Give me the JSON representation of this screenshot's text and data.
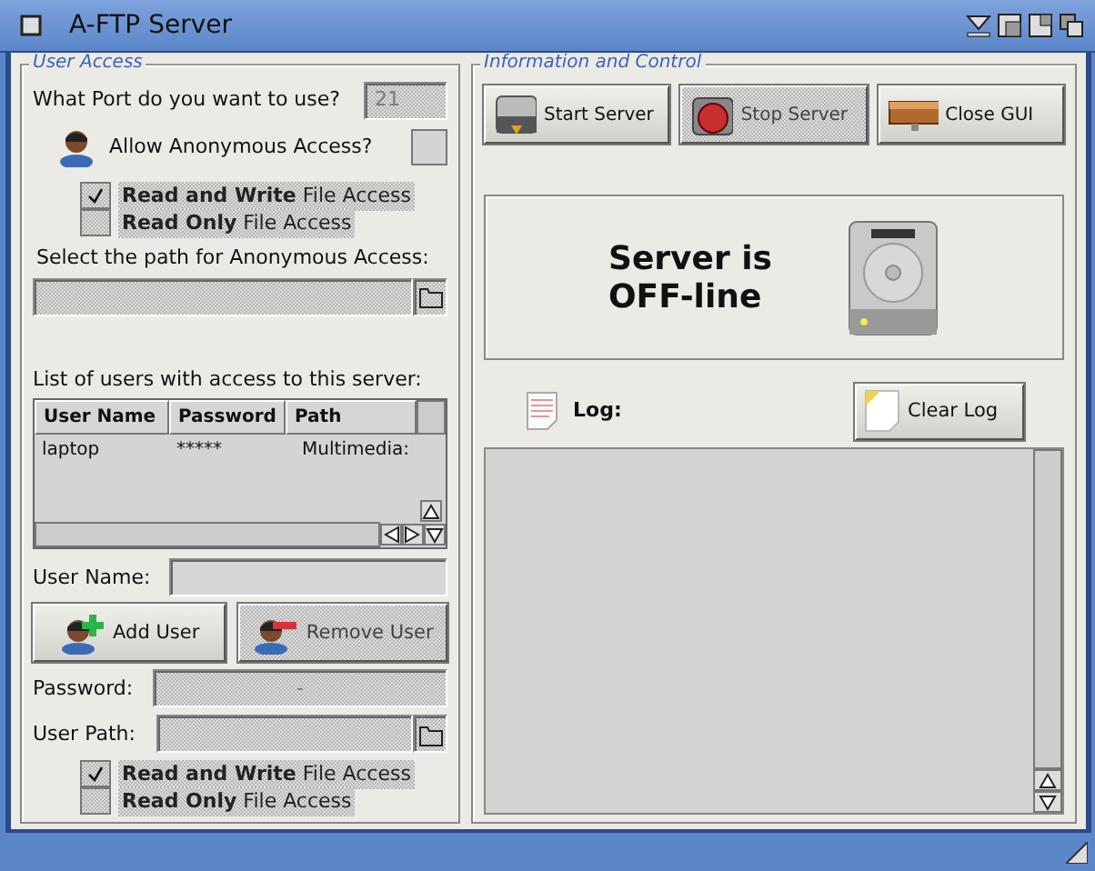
{
  "window": {
    "title": "A-FTP Server"
  },
  "user_access": {
    "title": "User Access",
    "port": {
      "label": "What Port do you want to use?",
      "value": "21",
      "disabled": true
    },
    "anonymous": {
      "label": "Allow Anonymous Access?",
      "checked": false
    },
    "anon_permissions": [
      {
        "label": "**Read and Write** File Access",
        "checked": true,
        "disabled": true
      },
      {
        "label": "**Read Only** File Access",
        "checked": false,
        "disabled": true
      }
    ],
    "anon_path": {
      "label": "Select the path for Anonymous Access:",
      "disabled": true
    },
    "users_label": "List of users with access to this server:",
    "users_table": {
      "columns": [
        "User Name",
        "Password",
        "Path"
      ],
      "rows": [
        [
          "laptop",
          "*****",
          "Multimedia:"
        ]
      ]
    },
    "user_name": {
      "label": "User Name:"
    },
    "buttons": [
      {
        "label": "Add User",
        "kind": "add",
        "disabled": false
      },
      {
        "label": "Remove User",
        "kind": "remove",
        "disabled": true
      }
    ],
    "password": {
      "label": "Password:",
      "value": "-",
      "disabled": true
    },
    "user_path": {
      "label": "User Path:",
      "disabled": true
    },
    "user_permissions": [
      {
        "label": "**Read and Write** File Access",
        "checked": true,
        "disabled": true
      },
      {
        "label": "**Read Only** File Access",
        "checked": false,
        "disabled": true
      }
    ]
  },
  "info": {
    "title": "Information and Control",
    "buttons": [
      {
        "label": "Start Server",
        "kind": "start",
        "disabled": false
      },
      {
        "label": "Stop Server",
        "kind": "stop",
        "disabled": true
      },
      {
        "label": "Close GUI",
        "kind": "close",
        "disabled": false
      }
    ],
    "status_lines": [
      "Server is",
      "OFF-line"
    ],
    "log_label": "Log:",
    "clear_button": "Clear Log"
  }
}
